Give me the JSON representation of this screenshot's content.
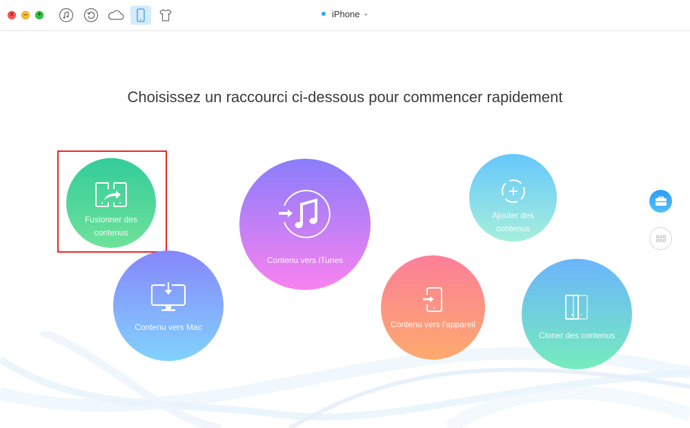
{
  "titlebar": {
    "window_controls": [
      "close",
      "minimize",
      "maximize"
    ],
    "toolbar": [
      {
        "name": "music-icon",
        "active": false
      },
      {
        "name": "restore-icon",
        "active": false
      },
      {
        "name": "cloud-icon",
        "active": false
      },
      {
        "name": "phone-icon",
        "active": true
      },
      {
        "name": "shirt-icon",
        "active": false
      }
    ],
    "device_name": "iPhone",
    "device_status_color": "#2aa7f2",
    "chevron": "⌄"
  },
  "main": {
    "headline": "Choisissez un raccourci ci-dessous pour commencer rapidement",
    "shortcuts": [
      {
        "id": "fusion",
        "line1": "Fusionner des",
        "line2": "contenus",
        "icon": "merge-devices-icon",
        "highlighted": true
      },
      {
        "id": "mac",
        "label": "Contenu vers Mac",
        "icon": "computer-download-icon"
      },
      {
        "id": "itunes",
        "label": "Contenu vers iTunes",
        "icon": "itunes-transfer-icon"
      },
      {
        "id": "ajout",
        "line1": "Ajouter des",
        "line2": "contenus",
        "icon": "add-content-icon"
      },
      {
        "id": "device",
        "label": "Contenu vers l’appareil",
        "icon": "to-device-icon"
      },
      {
        "id": "clone",
        "label": "Cloner des contenus",
        "icon": "clone-device-icon"
      }
    ]
  },
  "sidebar": {
    "tools_button": "toolbox-icon",
    "grid_button": "apps-grid-icon"
  },
  "colors": {
    "highlight": "#e8261a",
    "accent": "#2c9df5"
  }
}
